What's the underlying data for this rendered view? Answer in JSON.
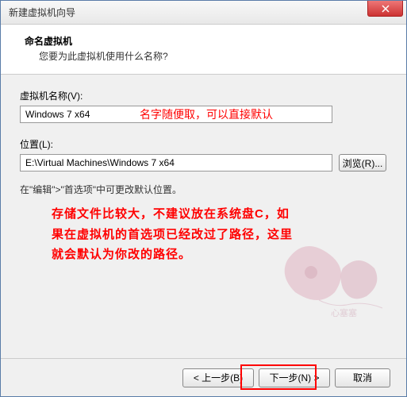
{
  "window": {
    "title": "新建虚拟机向导"
  },
  "header": {
    "title": "命名虚拟机",
    "subtitle": "您要为此虚拟机使用什么名称?"
  },
  "fields": {
    "name_label": "虚拟机名称(V):",
    "name_value": "Windows 7 x64",
    "name_annotation": "名字随便取，可以直接默认",
    "location_label": "位置(L):",
    "location_value": "E:\\Virtual Machines\\Windows 7 x64",
    "browse_label": "浏览(R)..."
  },
  "hint": "在\"编辑\">\"首选项\"中可更改默认位置。",
  "storage_note_line1": "存储文件比较大，不建议放在系统盘C，如",
  "storage_note_line2": "果在虚拟机的首选项已经改过了路径，这里",
  "storage_note_line3": "就会默认为你改的路径。",
  "buttons": {
    "back": "< 上一步(B)",
    "next": "下一步(N) >",
    "cancel": "取消"
  }
}
